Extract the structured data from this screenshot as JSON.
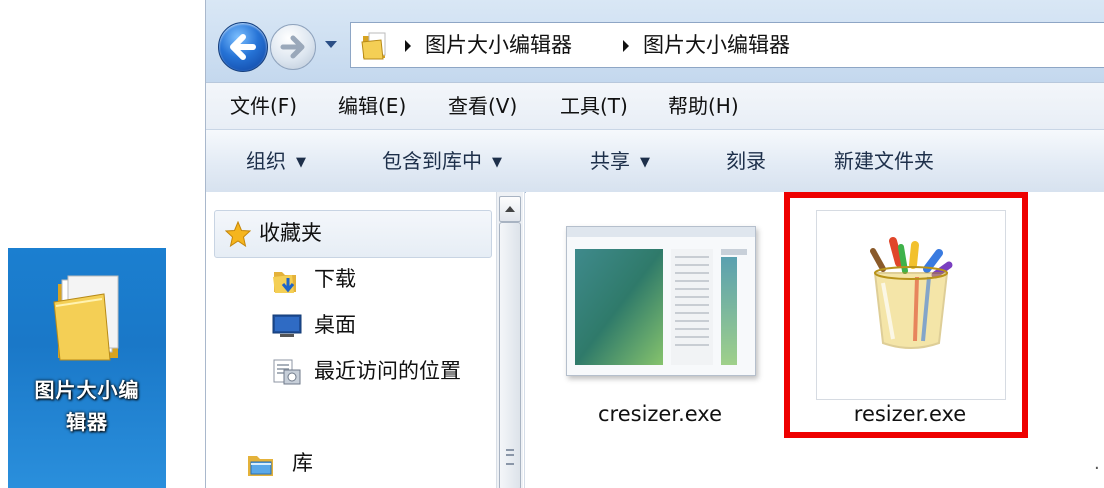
{
  "desktop": {
    "shortcut_label": "图片大小编辑器"
  },
  "window": {
    "breadcrumbs": [
      "图片大小编辑器",
      "图片大小编辑器"
    ],
    "menu": [
      "文件(F)",
      "编辑(E)",
      "查看(V)",
      "工具(T)",
      "帮助(H)"
    ],
    "toolbar": [
      {
        "label": "组织",
        "dropdown": true
      },
      {
        "label": "包含到库中",
        "dropdown": true
      },
      {
        "label": "共享",
        "dropdown": true
      },
      {
        "label": "刻录",
        "dropdown": false
      },
      {
        "label": "新建文件夹",
        "dropdown": false
      }
    ]
  },
  "navigation": {
    "favorites": "收藏夹",
    "items": [
      {
        "label": "下载",
        "icon": "download-folder-icon"
      },
      {
        "label": "桌面",
        "icon": "desktop-icon"
      },
      {
        "label": "最近访问的位置",
        "icon": "recent-places-icon"
      }
    ],
    "library": "库"
  },
  "files": [
    {
      "name": "cresizer.exe",
      "icon": "app-window-thumbnail"
    },
    {
      "name": "resizer.exe",
      "icon": "paintbrush-cup-icon",
      "highlighted": true
    }
  ],
  "colors": {
    "highlight": "#ee0000",
    "desktop_bg": "#1b7fd0",
    "titlebar": "#d9e7f5"
  }
}
